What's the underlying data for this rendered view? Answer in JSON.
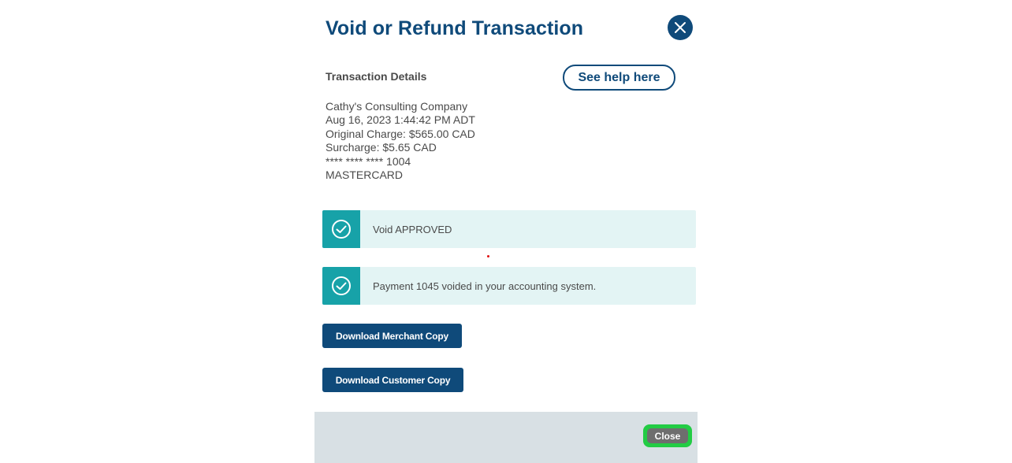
{
  "modal": {
    "title": "Void or Refund Transaction",
    "close_icon": "close-x-icon",
    "section_label": "Transaction Details",
    "help_button_label": "See help here"
  },
  "transaction": {
    "lines": [
      "Cathy's Consulting Company",
      "Aug 16, 2023 1:44:42 PM ADT",
      "Original Charge: $565.00 CAD",
      "Surcharge: $5.65 CAD",
      "**** **** **** 1004",
      "MASTERCARD"
    ]
  },
  "alerts": [
    {
      "icon": "check-circle-icon",
      "text": "Void APPROVED"
    },
    {
      "icon": "check-circle-icon",
      "text": "Payment 1045 voided in your accounting system."
    }
  ],
  "buttons": {
    "download_merchant": "Download Merchant Copy",
    "download_customer": "Download Customer Copy"
  },
  "footer": {
    "close_label": "Close"
  },
  "colors": {
    "primary": "#0f4a7a",
    "teal": "#17a2a8",
    "alert_bg": "#e3f4f4",
    "footer_bg": "#d8e0e4",
    "highlight_green": "#22cc44"
  }
}
